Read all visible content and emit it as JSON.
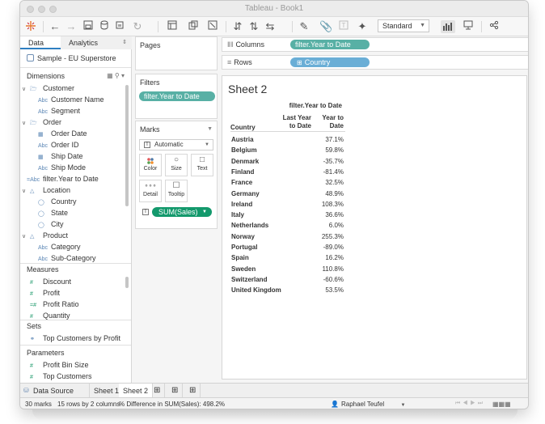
{
  "window": {
    "title": "Tableau - Book1"
  },
  "toolbar": {
    "view_size": "Standard"
  },
  "data_pane": {
    "tabs": [
      "Data",
      "Analytics"
    ],
    "source": "Sample - EU Superstore",
    "dimensions_label": "Dimensions",
    "dimension_groups": [
      {
        "name": "Customer",
        "fields": [
          "Customer Name",
          "Segment"
        ]
      },
      {
        "name": "Order",
        "fields": [
          "Order Date",
          "Order ID",
          "Ship Date",
          "Ship Mode"
        ]
      }
    ],
    "calc_field": "filter.Year to Date",
    "location": {
      "name": "Location",
      "fields": [
        "Country",
        "State",
        "City"
      ]
    },
    "product": {
      "name": "Product",
      "fields": [
        "Category",
        "Sub-Category"
      ]
    },
    "measures_label": "Measures",
    "measures": [
      "Discount",
      "Profit",
      "Profit Ratio",
      "Quantity"
    ],
    "sets_label": "Sets",
    "sets": [
      "Top Customers by Profit"
    ],
    "parameters_label": "Parameters",
    "parameters": [
      "Profit Bin Size",
      "Top Customers"
    ]
  },
  "cards": {
    "pages": "Pages",
    "filters": "Filters",
    "filter_pill": "filter.Year to Date",
    "marks": "Marks",
    "mark_type": "Automatic",
    "mark_buttons": [
      "Color",
      "Size",
      "Text",
      "Detail",
      "Tooltip"
    ],
    "marks_pill": "SUM(Sales)"
  },
  "shelves": {
    "columns_label": "Columns",
    "columns_pill": "filter.Year to Date",
    "rows_label": "Rows",
    "rows_pill": "Country"
  },
  "view": {
    "title": "Sheet 2",
    "header_group": "filter.Year to Date",
    "row_header": "Country",
    "col1_line1": "Last Year",
    "col1_line2": "to Date",
    "col2_line1": "Year to",
    "col2_line2": "Date",
    "rows": [
      {
        "country": "Austria",
        "ytd": "37.1%"
      },
      {
        "country": "Belgium",
        "ytd": "59.8%"
      },
      {
        "country": "Denmark",
        "ytd": "-35.7%"
      },
      {
        "country": "Finland",
        "ytd": "-81.4%"
      },
      {
        "country": "France",
        "ytd": "32.5%"
      },
      {
        "country": "Germany",
        "ytd": "48.9%"
      },
      {
        "country": "Ireland",
        "ytd": "108.3%"
      },
      {
        "country": "Italy",
        "ytd": "36.6%"
      },
      {
        "country": "Netherlands",
        "ytd": "6.0%"
      },
      {
        "country": "Norway",
        "ytd": "255.3%"
      },
      {
        "country": "Portugal",
        "ytd": "-89.0%"
      },
      {
        "country": "Spain",
        "ytd": "16.2%"
      },
      {
        "country": "Sweden",
        "ytd": "110.8%"
      },
      {
        "country": "Switzerland",
        "ytd": "-60.6%"
      },
      {
        "country": "United Kingdom",
        "ytd": "53.5%"
      }
    ]
  },
  "sheet_tabs": {
    "data_source": "Data Source",
    "sheets": [
      "Sheet 1",
      "Sheet 2"
    ]
  },
  "status": {
    "marks": "30 marks",
    "dims": "15 rows by 2 columns",
    "summary": "% Difference in SUM(Sales): 498.2%",
    "user": "Raphael Teufel"
  },
  "colors": {
    "pill_green": "#13996c",
    "pill_teal": "#58b0a5",
    "pill_blue": "#6aaed6"
  }
}
